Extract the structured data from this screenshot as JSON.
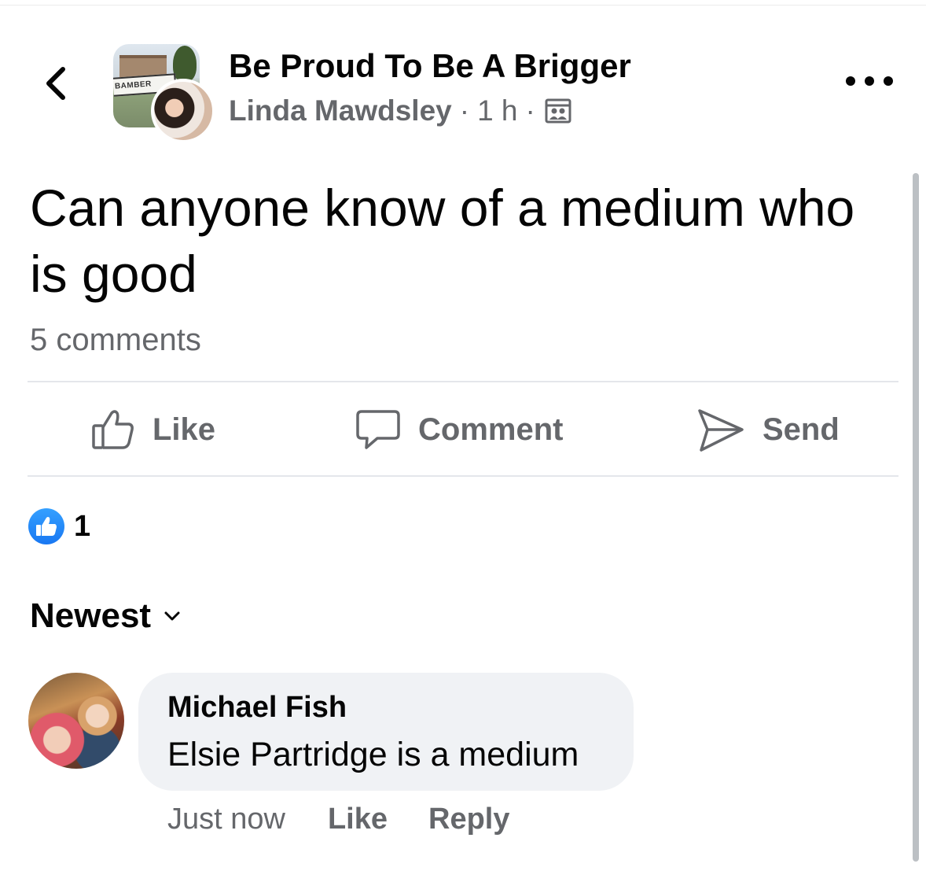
{
  "header": {
    "group_name": "Be Proud To Be A Brigger",
    "author": "Linda Mawdsley",
    "separator": "·",
    "time": "1 h",
    "group_thumb_sign": "BAMBER",
    "icons": {
      "back": "chevron-left-icon",
      "privacy": "group-members-icon",
      "more": "more-options-icon"
    }
  },
  "post": {
    "text": "Can anyone know of a medium who is good",
    "comments_count": "5 comments"
  },
  "actions": {
    "like_label": "Like",
    "comment_label": "Comment",
    "send_label": "Send"
  },
  "reactions": {
    "count": "1",
    "color": "#1877f2"
  },
  "sort": {
    "label": "Newest"
  },
  "comments": [
    {
      "author": "Michael Fish",
      "text": "Elsie Partridge is a medium",
      "timestamp": "Just now",
      "like_label": "Like",
      "reply_label": "Reply"
    }
  ],
  "colors": {
    "text_primary": "#050505",
    "text_secondary": "#65676b",
    "bubble": "#f0f2f5",
    "divider": "#e4e6eb"
  }
}
